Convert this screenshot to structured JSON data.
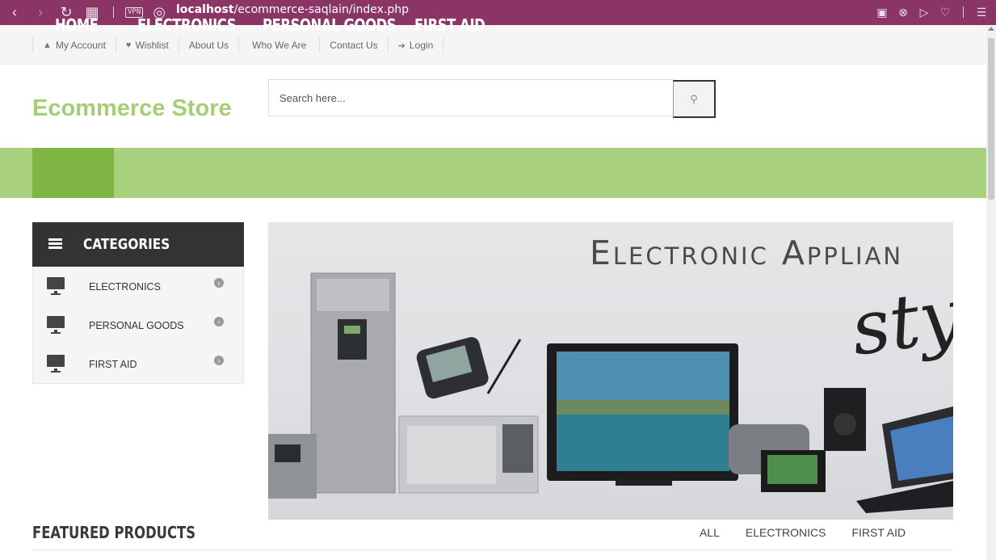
{
  "browser": {
    "url_host": "localhost",
    "url_path": "/ecommerce-saqlain/index.php",
    "vpn_label": "VPN",
    "icons": [
      "back-icon",
      "forward-icon",
      "reload-icon",
      "tabs-grid-icon",
      "globe-icon",
      "camera-icon",
      "adblock-icon",
      "send-icon",
      "heart-icon",
      "menu-icon"
    ]
  },
  "toplinks": [
    {
      "label": "My Account",
      "icon": "user-icon"
    },
    {
      "label": "Wishlist",
      "icon": "heart-icon"
    },
    {
      "label": "About Us",
      "icon": ""
    },
    {
      "label": "Who We Are",
      "icon": ""
    },
    {
      "label": "Contact Us",
      "icon": ""
    },
    {
      "label": "Login",
      "icon": "login-icon"
    }
  ],
  "header": {
    "logo": "Ecommerce Store",
    "search_placeholder": "Search here..."
  },
  "nav": [
    {
      "label": "HOME",
      "active": true
    },
    {
      "label": "ELECTRONICS",
      "active": false
    },
    {
      "label": "PERSONAL GOODS",
      "active": false
    },
    {
      "label": "FIRST AID",
      "active": false
    }
  ],
  "categories": {
    "title": "CATEGORIES",
    "items": [
      {
        "label": "ELECTRONICS"
      },
      {
        "label": "PERSONAL GOODS"
      },
      {
        "label": "FIRST AID"
      }
    ]
  },
  "banner": {
    "title": "Electronic Applian",
    "script": "sty"
  },
  "featured": {
    "title": "FEATURED PRODUCTS",
    "tabs": [
      "ALL",
      "ELECTRONICS",
      "FIRST AID"
    ]
  },
  "colors": {
    "browser_bar": "#8a3566",
    "logo": "#a5cf75",
    "nav_bg": "#a9d07e",
    "nav_active": "#7fb643",
    "category_header": "#333333"
  }
}
